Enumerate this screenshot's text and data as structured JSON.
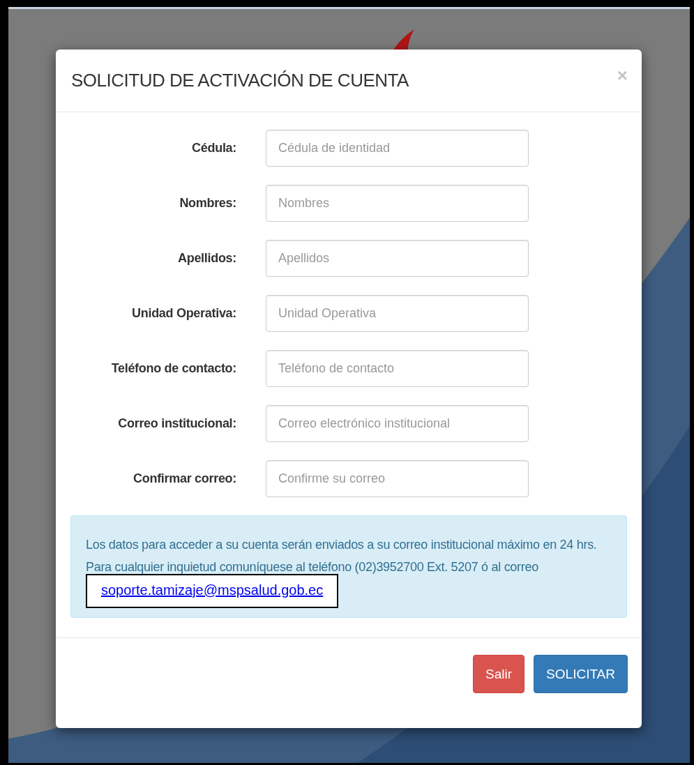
{
  "modal": {
    "title": "SOLICITUD DE ACTIVACIÓN DE CUENTA",
    "close": "×",
    "fields": [
      {
        "label": "Cédula:",
        "placeholder": "Cédula de identidad"
      },
      {
        "label": "Nombres:",
        "placeholder": "Nombres"
      },
      {
        "label": "Apellidos:",
        "placeholder": "Apellidos"
      },
      {
        "label": "Unidad Operativa:",
        "placeholder": "Unidad Operativa"
      },
      {
        "label": "Teléfono de contacto:",
        "placeholder": "Teléfono de contacto"
      },
      {
        "label": "Correo institucional:",
        "placeholder": "Correo electrónico institucional"
      },
      {
        "label": "Confirmar correo:",
        "placeholder": "Confirme su correo"
      }
    ],
    "info": {
      "text": "Los datos para acceder a su cuenta serán enviados a su correo institucional máximo en 24 hrs. Para cualquier inquietud comuníquese al teléfono (02)3952700 Ext. 5207 ó al correo",
      "link": "soporte.tamizaje@mspsalud.gob.ec"
    },
    "buttons": [
      {
        "kind": "danger",
        "label": "Salir"
      },
      {
        "kind": "primary",
        "label": "SOLICITAR"
      }
    ]
  }
}
